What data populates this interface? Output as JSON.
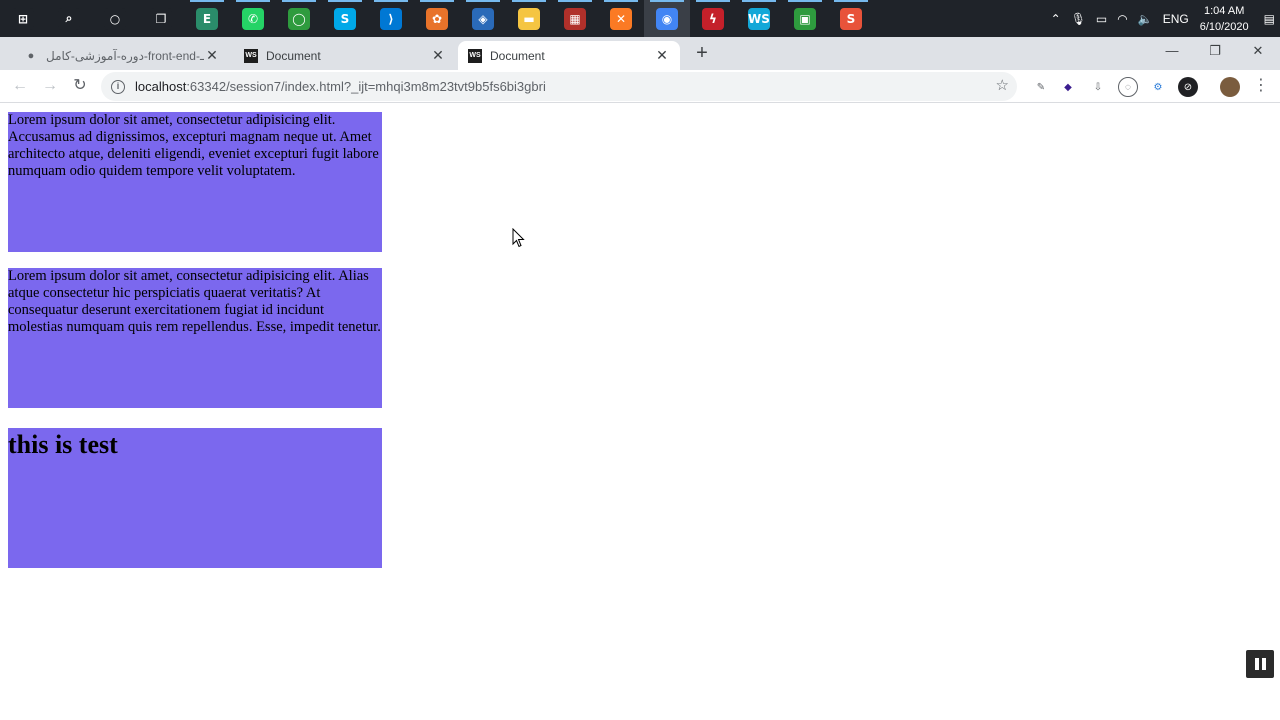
{
  "taskbar": {
    "icons": [
      {
        "name": "windows-start-icon",
        "glyph": "⊞",
        "color": "#1f2329"
      },
      {
        "name": "search-icon",
        "glyph": "⌕",
        "color": "#1f2329"
      },
      {
        "name": "cortana-icon",
        "glyph": "○",
        "color": "#1f2329"
      },
      {
        "name": "task-view-icon",
        "glyph": "❐",
        "color": "#1f2329"
      },
      {
        "name": "editor-app-icon",
        "glyph": "E",
        "color": "#2a8c6a"
      },
      {
        "name": "whatsapp-icon",
        "glyph": "✆",
        "color": "#25d366"
      },
      {
        "name": "circle-app-icon",
        "glyph": "◯",
        "color": "#2e9b3e"
      },
      {
        "name": "skype-icon",
        "glyph": "S",
        "color": "#00a8e8"
      },
      {
        "name": "vscode-icon",
        "glyph": "⟩",
        "color": "#0078d4"
      },
      {
        "name": "color-app-icon",
        "glyph": "✿",
        "color": "#e8732a"
      },
      {
        "name": "virtualbox-icon",
        "glyph": "◈",
        "color": "#2a6ab8"
      },
      {
        "name": "file-explorer-icon",
        "glyph": "▬",
        "color": "#f5c542"
      },
      {
        "name": "winrar-icon",
        "glyph": "▦",
        "color": "#b0302a"
      },
      {
        "name": "xampp-icon",
        "glyph": "✕",
        "color": "#fb7a24"
      },
      {
        "name": "chrome-icon",
        "glyph": "◉",
        "color": "#4285f4"
      },
      {
        "name": "flash-icon",
        "glyph": "ϟ",
        "color": "#c4202a"
      },
      {
        "name": "webstorm-icon",
        "glyph": "WS",
        "color": "#13a8d8"
      },
      {
        "name": "chip-app-icon",
        "glyph": "▣",
        "color": "#2e9b3e"
      },
      {
        "name": "sublime-icon",
        "glyph": "S",
        "color": "#e8533a"
      }
    ],
    "tray": {
      "language": "ENG",
      "time": "1:04 AM",
      "date": "6/10/2020"
    }
  },
  "tabs": [
    {
      "title": "دوره-آموزشی-کامل-front-end-بوتـ",
      "close": "✕"
    },
    {
      "title": "Document",
      "close": "✕"
    },
    {
      "title": "Document",
      "close": "✕"
    }
  ],
  "omnibox": {
    "host": "localhost",
    "path": ":63342/session7/index.html?_ijt=mhqi3m8m23tvt9b5fs6bi3gbri"
  },
  "content": {
    "box1": "Lorem ipsum dolor sit amet, consectetur adipisicing elit. Accusamus ad dignissimos, excepturi magnam neque ut. Amet architecto atque, deleniti eligendi, eveniet excepturi fugit labore numquam odio quidem tempore velit voluptatem.",
    "box2": "Lorem ipsum dolor sit amet, consectetur adipisicing elit. Alias atque consectetur hic perspiciatis quaerat veritatis? At consequatur deserunt exercitationem fugiat id incidunt molestias numquam quis rem repellendus. Esse, impedit tenetur.",
    "box3": "this is test"
  },
  "colors": {
    "box_background": "#7b68ee",
    "taskbar": "#1f2329",
    "tabstrip": "#dee1e6"
  }
}
